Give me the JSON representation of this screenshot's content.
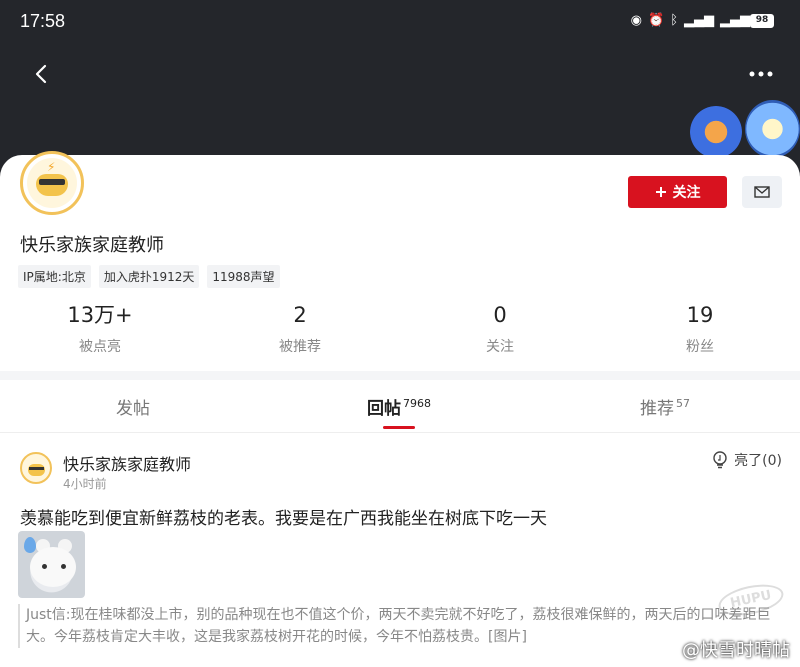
{
  "status_bar": {
    "time": "17:58",
    "battery": "98"
  },
  "profile": {
    "username": "快乐家族家庭教师",
    "follow_label": "关注",
    "tags": [
      "IP属地:北京",
      "加入虎扑1912天",
      "11988声望"
    ],
    "stats": [
      {
        "value": "13万+",
        "label": "被点亮"
      },
      {
        "value": "2",
        "label": "被推荐"
      },
      {
        "value": "0",
        "label": "关注"
      },
      {
        "value": "19",
        "label": "粉丝"
      }
    ]
  },
  "tabs": [
    {
      "label": "发帖",
      "count": ""
    },
    {
      "label": "回帖",
      "count": "7968"
    },
    {
      "label": "推荐",
      "count": "57"
    }
  ],
  "post": {
    "author": "快乐家族家庭教师",
    "time": "4小时前",
    "like_label": "亮了(0)",
    "text": "羡慕能吃到便宜新鲜荔枝的老表。我要是在广西我能坐在树底下吃一天",
    "quote": "Just信:现在桂味都没上市，别的品种现在也不值这个价，两天不卖完就不好吃了，荔枝很难保鲜的，两天后的口味差距巨大。今年荔枝肯定大丰收，这是我家荔枝树开花的时候，今年不怕荔枝贵。[图片]"
  },
  "watermark": "@快雪时晴帖",
  "hupu_mark": "HUPU",
  "colors": {
    "accent": "#d8121f",
    "header_bg": "#24262b"
  }
}
